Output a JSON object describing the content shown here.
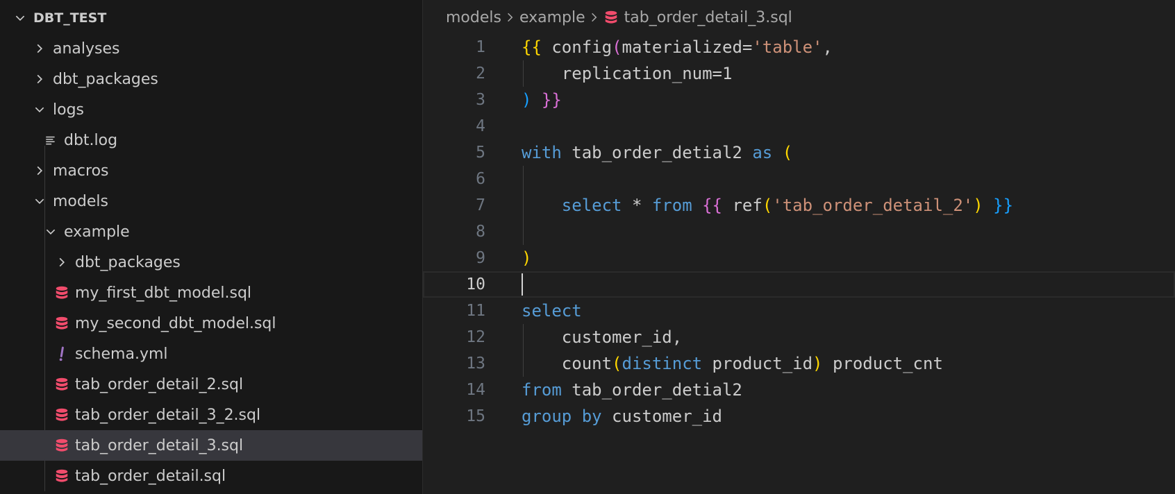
{
  "explorer": {
    "root": "DBT_TEST",
    "items": {
      "analyses": "analyses",
      "dbt_packages": "dbt_packages",
      "logs": "logs",
      "dbt_log": "dbt.log",
      "macros": "macros",
      "models": "models",
      "example": "example",
      "example_dbt_packages": "dbt_packages",
      "my_first": "my_first_dbt_model.sql",
      "my_second": "my_second_dbt_model.sql",
      "schema": "schema.yml",
      "tab2": "tab_order_detail_2.sql",
      "tab3_2": "tab_order_detail_3_2.sql",
      "tab3": "tab_order_detail_3.sql",
      "tab": "tab_order_detail.sql"
    }
  },
  "breadcrumb": {
    "part1": "models",
    "part2": "example",
    "file": "tab_order_detail_3.sql"
  },
  "editor": {
    "line_numbers": [
      "1",
      "2",
      "3",
      "4",
      "5",
      "6",
      "7",
      "8",
      "9",
      "10",
      "11",
      "12",
      "13",
      "14",
      "15"
    ],
    "active_line": "10",
    "code": {
      "l1": [
        "{{",
        " config",
        "(",
        "materialized=",
        "'table'",
        ","
      ],
      "l2": [
        "replication_num=1"
      ],
      "l3": [
        ")",
        " }}"
      ],
      "l5": [
        "with",
        " tab_order_detial2 ",
        "as",
        " ("
      ],
      "l7": [
        "select",
        " * ",
        "from",
        " ",
        "{{",
        " ref",
        "(",
        "'tab_order_detail_2'",
        ")",
        " }}"
      ],
      "l9": [
        ")"
      ],
      "l11": [
        "select"
      ],
      "l12": [
        "customer_id,"
      ],
      "l13": [
        "count",
        "(",
        "distinct",
        " product_id",
        ")",
        " product_cnt"
      ],
      "l14": [
        "from",
        " tab_order_detial2"
      ],
      "l15": [
        "group by",
        " customer_id"
      ]
    }
  },
  "colors": {
    "keyword": "#569cd6",
    "string": "#ce9178",
    "bracket1": "#ffd700",
    "bracket2": "#da70d6",
    "bracket3": "#179fff",
    "sql_icon": "#f14c6c",
    "yaml_icon": "#a074c4"
  },
  "icons": {
    "chevron_right": "chevron-right-icon",
    "chevron_down": "chevron-down-icon",
    "sql_file": "database-icon",
    "yaml_file": "exclamation-icon",
    "log_file": "lines-icon"
  }
}
